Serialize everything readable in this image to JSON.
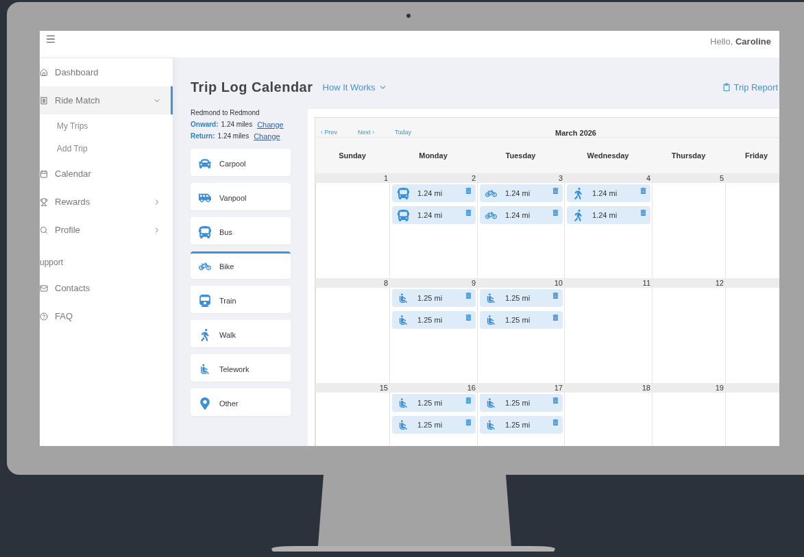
{
  "topbar": {
    "greeting": "Hello,",
    "user": "Caroline"
  },
  "sidebar": {
    "items": [
      {
        "label": "Dashboard",
        "selected": false
      },
      {
        "label": "Ride Match",
        "selected": true,
        "expanded": true,
        "children": [
          {
            "label": "My Trips"
          },
          {
            "label": "Add Trip"
          }
        ]
      },
      {
        "label": "Calendar",
        "selected": false
      },
      {
        "label": "Rewards",
        "selected": false,
        "expanded": false
      },
      {
        "label": "Profile",
        "selected": false,
        "expanded": false
      }
    ],
    "section": "upport",
    "support_items": [
      {
        "label": "Contacts"
      },
      {
        "label": "FAQ"
      }
    ]
  },
  "page": {
    "title": "Trip Log Calendar",
    "help_link": "How It Works",
    "report_link": "Trip Report"
  },
  "route": {
    "name": "Redmond to Redmond",
    "legs": [
      {
        "label": "Onward:",
        "distance": "1.24 miles",
        "action": "Change"
      },
      {
        "label": "Return:",
        "distance": "1.24 miles",
        "action": "Change"
      }
    ]
  },
  "modes": [
    {
      "kind": "car",
      "label": "Carpool",
      "selected": false
    },
    {
      "kind": "van",
      "label": "Vanpool",
      "selected": false
    },
    {
      "kind": "bus",
      "label": "Bus",
      "selected": false
    },
    {
      "kind": "bike",
      "label": "Bike",
      "selected": true
    },
    {
      "kind": "train",
      "label": "Train",
      "selected": false
    },
    {
      "kind": "walk",
      "label": "Walk",
      "selected": false
    },
    {
      "kind": "telework",
      "label": "Telework",
      "selected": false
    },
    {
      "kind": "other",
      "label": "Other",
      "selected": false
    }
  ],
  "calendar": {
    "prev": "‹ Prev",
    "next": "Next ›",
    "today": "Today",
    "title": "March 2026",
    "weekdays": [
      "Sunday",
      "Monday",
      "Tuesday",
      "Wednesday",
      "Thursday",
      "Friday"
    ],
    "weeks": [
      {
        "days": [
          {
            "number": "1"
          },
          {
            "number": "2",
            "trips": [
              {
                "kind": "bus",
                "distance": "1.24 mi"
              },
              {
                "kind": "bus",
                "distance": "1.24 mi"
              }
            ]
          },
          {
            "number": "3",
            "trips": [
              {
                "kind": "bike",
                "distance": "1.24 mi"
              },
              {
                "kind": "bike",
                "distance": "1.24 mi"
              }
            ]
          },
          {
            "number": "4",
            "trips": [
              {
                "kind": "walk",
                "distance": "1.24 mi"
              },
              {
                "kind": "walk",
                "distance": "1.24 mi"
              }
            ]
          },
          {
            "number": "5"
          }
        ]
      },
      {
        "days": [
          {
            "number": "8"
          },
          {
            "number": "9",
            "trips": [
              {
                "kind": "telework",
                "distance": "1.25 mi"
              },
              {
                "kind": "telework",
                "distance": "1.25 mi"
              }
            ]
          },
          {
            "number": "10",
            "trips": [
              {
                "kind": "telework",
                "distance": "1.25 mi"
              },
              {
                "kind": "telework",
                "distance": "1.25 mi"
              }
            ]
          },
          {
            "number": "11"
          },
          {
            "number": "12"
          }
        ]
      },
      {
        "days": [
          {
            "number": "15"
          },
          {
            "number": "16",
            "trips": [
              {
                "kind": "telework",
                "distance": "1.25 mi"
              },
              {
                "kind": "telework",
                "distance": "1.25 mi"
              }
            ]
          },
          {
            "number": "17",
            "trips": [
              {
                "kind": "telework",
                "distance": "1.25 mi"
              },
              {
                "kind": "telework",
                "distance": "1.25 mi"
              }
            ]
          },
          {
            "number": "18"
          },
          {
            "number": "19"
          }
        ]
      }
    ]
  }
}
